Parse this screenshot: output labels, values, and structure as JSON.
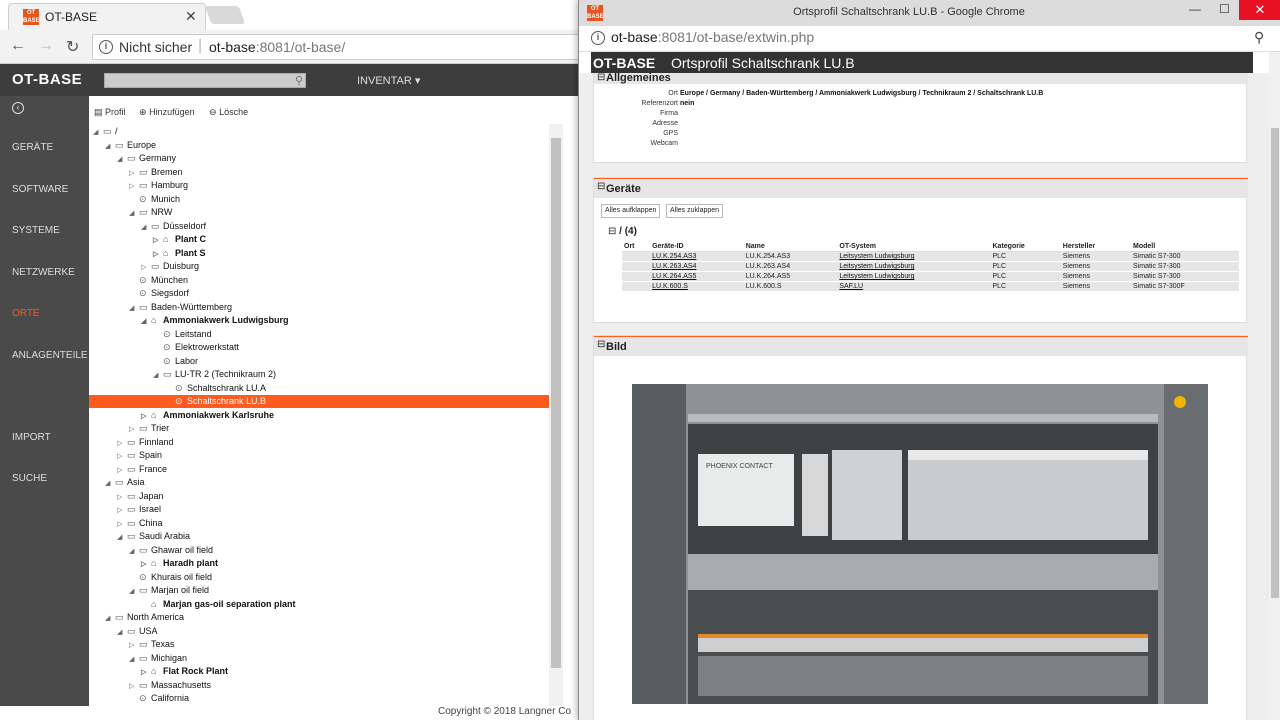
{
  "browser": {
    "tab_title": "OT-BASE",
    "not_secure": "Nicht sicher",
    "url_host": "ot-base",
    "url_rest": ":8081/ot-base/"
  },
  "app": {
    "logo": "OT-BASE",
    "inventar": "INVENTAR ▾",
    "footer": "Copyright © 2018 Langner Co"
  },
  "sidebar": [
    {
      "label": "GERÄTE",
      "active": false
    },
    {
      "label": "SOFTWARE",
      "active": false
    },
    {
      "label": "SYSTEME",
      "active": false
    },
    {
      "label": "NETZWERKE",
      "active": false
    },
    {
      "label": "ORTE",
      "active": true
    },
    {
      "label": "ANLAGENTEILE",
      "active": false
    },
    {
      "label": "IMPORT",
      "active": false
    },
    {
      "label": "SUCHE",
      "active": false
    }
  ],
  "toolbar": {
    "profil": "Profil",
    "add": "Hinzufügen",
    "delete": "Lösche"
  },
  "tree": [
    {
      "label": "/",
      "depth": 0,
      "exp": "open",
      "icon": "folder"
    },
    {
      "label": "Europe",
      "depth": 1,
      "exp": "open",
      "icon": "folder"
    },
    {
      "label": "Germany",
      "depth": 2,
      "exp": "open",
      "icon": "folder"
    },
    {
      "label": "Bremen",
      "depth": 3,
      "exp": "closed",
      "icon": "folder"
    },
    {
      "label": "Hamburg",
      "depth": 3,
      "exp": "closed",
      "icon": "folder"
    },
    {
      "label": "Munich",
      "depth": 3,
      "exp": "",
      "icon": "pin"
    },
    {
      "label": "NRW",
      "depth": 3,
      "exp": "open",
      "icon": "folder"
    },
    {
      "label": "Düsseldorf",
      "depth": 4,
      "exp": "open",
      "icon": "folder"
    },
    {
      "label": "Plant C",
      "depth": 5,
      "exp": "closed",
      "icon": "house",
      "bold": true
    },
    {
      "label": "Plant S",
      "depth": 5,
      "exp": "closed",
      "icon": "house",
      "bold": true
    },
    {
      "label": "Duisburg",
      "depth": 4,
      "exp": "closed",
      "icon": "folder"
    },
    {
      "label": "München",
      "depth": 3,
      "exp": "",
      "icon": "pin"
    },
    {
      "label": "Siegsdorf",
      "depth": 3,
      "exp": "",
      "icon": "pin"
    },
    {
      "label": "Baden-Württemberg",
      "depth": 3,
      "exp": "open",
      "icon": "folder"
    },
    {
      "label": "Ammoniakwerk Ludwigsburg",
      "depth": 4,
      "exp": "open",
      "icon": "house",
      "bold": true
    },
    {
      "label": "Leitstand",
      "depth": 5,
      "exp": "",
      "icon": "pin"
    },
    {
      "label": "Elektrowerkstatt",
      "depth": 5,
      "exp": "",
      "icon": "pin"
    },
    {
      "label": "Labor",
      "depth": 5,
      "exp": "",
      "icon": "pin"
    },
    {
      "label": "LU-TR 2 (Technikraum 2)",
      "depth": 5,
      "exp": "open",
      "icon": "folder"
    },
    {
      "label": "Schaltschrank LU.A",
      "depth": 6,
      "exp": "",
      "icon": "pin"
    },
    {
      "label": "Schaltschrank LU.B",
      "depth": 6,
      "exp": "",
      "icon": "pin",
      "selected": true
    },
    {
      "label": "Ammoniakwerk Karlsruhe",
      "depth": 4,
      "exp": "closed",
      "icon": "house",
      "bold": true
    },
    {
      "label": "Trier",
      "depth": 3,
      "exp": "closed",
      "icon": "folder"
    },
    {
      "label": "Finnland",
      "depth": 2,
      "exp": "closed",
      "icon": "folder"
    },
    {
      "label": "Spain",
      "depth": 2,
      "exp": "closed",
      "icon": "folder"
    },
    {
      "label": "France",
      "depth": 2,
      "exp": "closed",
      "icon": "folder"
    },
    {
      "label": "Asia",
      "depth": 1,
      "exp": "open",
      "icon": "folder"
    },
    {
      "label": "Japan",
      "depth": 2,
      "exp": "closed",
      "icon": "folder"
    },
    {
      "label": "Israel",
      "depth": 2,
      "exp": "closed",
      "icon": "folder"
    },
    {
      "label": "China",
      "depth": 2,
      "exp": "closed",
      "icon": "folder"
    },
    {
      "label": "Saudi Arabia",
      "depth": 2,
      "exp": "open",
      "icon": "folder"
    },
    {
      "label": "Ghawar oil field",
      "depth": 3,
      "exp": "open",
      "icon": "folder"
    },
    {
      "label": "Haradh plant",
      "depth": 4,
      "exp": "closed",
      "icon": "house",
      "bold": true
    },
    {
      "label": "Khurais oil field",
      "depth": 3,
      "exp": "",
      "icon": "pin"
    },
    {
      "label": "Marjan oil field",
      "depth": 3,
      "exp": "open",
      "icon": "folder"
    },
    {
      "label": "Marjan gas-oil separation plant",
      "depth": 4,
      "exp": "",
      "icon": "house",
      "bold": true
    },
    {
      "label": "North America",
      "depth": 1,
      "exp": "open",
      "icon": "folder"
    },
    {
      "label": "USA",
      "depth": 2,
      "exp": "open",
      "icon": "folder"
    },
    {
      "label": "Texas",
      "depth": 3,
      "exp": "closed",
      "icon": "folder"
    },
    {
      "label": "Michigan",
      "depth": 3,
      "exp": "open",
      "icon": "folder"
    },
    {
      "label": "Flat Rock Plant",
      "depth": 4,
      "exp": "closed",
      "icon": "house",
      "bold": true
    },
    {
      "label": "Massachusetts",
      "depth": 3,
      "exp": "closed",
      "icon": "folder"
    },
    {
      "label": "California",
      "depth": 3,
      "exp": "",
      "icon": "pin"
    }
  ],
  "popup": {
    "title": "Ortsprofil Schaltschrank LU.B - Google Chrome",
    "url_host": "ot-base",
    "url_rest": ":8081/ot-base/extwin.php",
    "header_logo": "OT-BASE",
    "header_text": "Ortsprofil  Schaltschrank LU.B",
    "allgemeines": {
      "title": "Allgemeines",
      "fields": [
        {
          "key": "Ort",
          "value": "Europe / Germany / Baden-Württemberg / Ammoniakwerk Ludwigsburg / Technikraum 2 / Schaltschrank LU.B"
        },
        {
          "key": "Referenzort",
          "value": "nein"
        },
        {
          "key": "Firma",
          "value": ""
        },
        {
          "key": "Adresse",
          "value": ""
        },
        {
          "key": "GPS",
          "value": ""
        },
        {
          "key": "Webcam",
          "value": ""
        }
      ]
    },
    "geraete": {
      "title": "Geräte",
      "expand_all": "Alles aufklappen",
      "collapse_all": "Alles zuklappen",
      "group": "/ (4)",
      "columns": [
        "Ort",
        "Geräte-ID",
        "Name",
        "OT-System",
        "Kategorie",
        "Hersteller",
        "Modell"
      ],
      "rows": [
        [
          "",
          "LU.K.254.AS3",
          "LU.K.254.AS3",
          "Leitsystem Ludwigsburg",
          "PLC",
          "Siemens",
          "Simatic S7-300"
        ],
        [
          "",
          "LU.K.263.AS4",
          "LU.K.263.AS4",
          "Leitsystem Ludwigsburg",
          "PLC",
          "Siemens",
          "Simatic S7-300"
        ],
        [
          "",
          "LU.K.264.AS5",
          "LU.K.264.AS5",
          "Leitsystem Ludwigsburg",
          "PLC",
          "Siemens",
          "Simatic S7-300"
        ],
        [
          "",
          "LU.K.600.S",
          "LU.K.600.S",
          "SAF.LU",
          "PLC",
          "Siemens",
          "Simatic S7-300F"
        ]
      ]
    },
    "bild": {
      "title": "Bild",
      "brand": "PHOENIX CONTACT"
    }
  }
}
